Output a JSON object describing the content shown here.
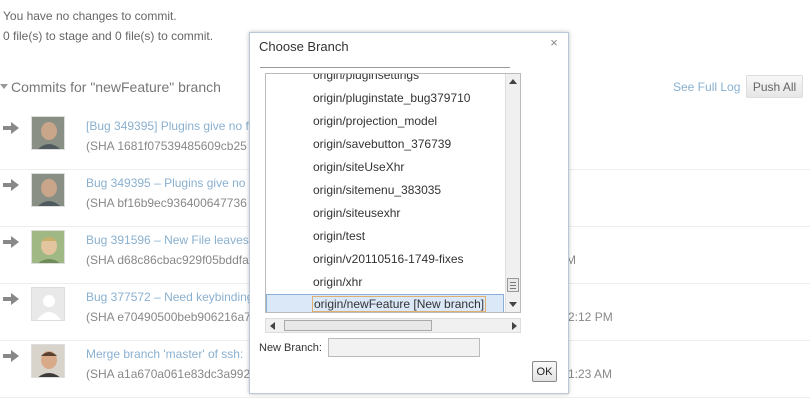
{
  "status": {
    "line1": "You have no changes to commit.",
    "line2": "0 file(s) to stage and 0 file(s) to commit."
  },
  "commits_section": {
    "title": "Commits for \"newFeature\" branch",
    "see_full_log": "See Full Log",
    "push_all": "Push All"
  },
  "commits": [
    {
      "message": "[Bug 349395] Plugins give no f",
      "sha": "(SHA 1681f07539485609cb25",
      "date": ""
    },
    {
      "message": "Bug 349395 – Plugins give no f",
      "sha": "(SHA bf16b9ec936400647736",
      "date": ""
    },
    {
      "message": "Bug 391596 – New File leaves g",
      "sha": "(SHA d68c86cbac929f05bddfa",
      "date": "M"
    },
    {
      "message": "Bug 377572 – Need keybinding",
      "sha": "(SHA e70490500beb906216a7",
      "date": "2:12 PM"
    },
    {
      "message": "Merge branch 'master' of ssh:",
      "sha": "(SHA a1a670a061e83dc3a992",
      "date": "1:23 AM"
    }
  ],
  "dialog": {
    "title": "Choose Branch",
    "close": "×",
    "branches": [
      "origin/pluginsettings",
      "origin/pluginstate_bug379710",
      "origin/projection_model",
      "origin/savebutton_376739",
      "origin/siteUseXhr",
      "origin/sitemenu_383035",
      "origin/siteusexhr",
      "origin/test",
      "origin/v20110516-1749-fixes",
      "origin/xhr",
      "origin/newFeature [New branch]"
    ],
    "new_branch_label": "New Branch:",
    "new_branch_value": "",
    "ok_label": "OK"
  },
  "colors": {
    "link": "#8ab0d0",
    "selection_bg": "#dbe8f8",
    "selection_border": "#8aaed6",
    "focus_outline": "#e0b070"
  }
}
